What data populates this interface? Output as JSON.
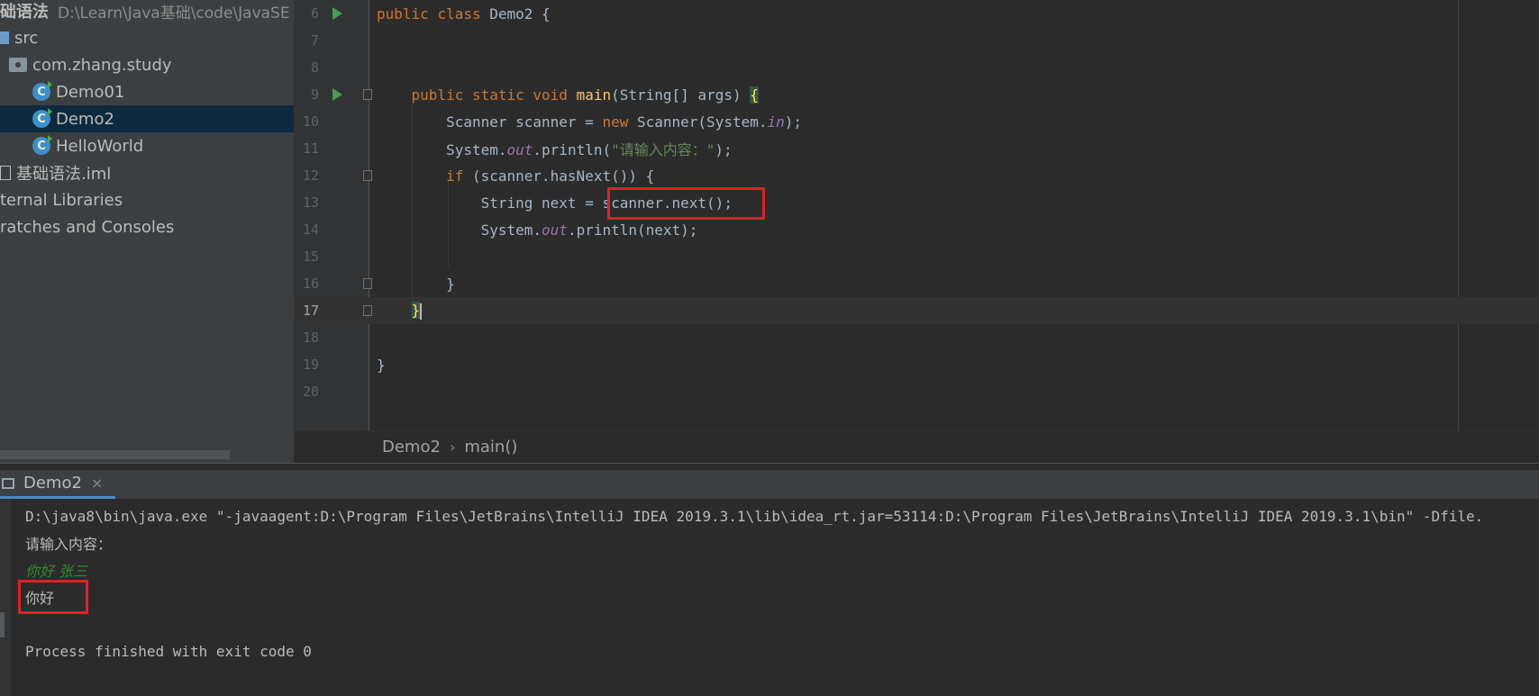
{
  "sidebar": {
    "root_name": "础语法",
    "root_path": "D:\\Learn\\Java基础\\code\\JavaSE",
    "items": [
      {
        "label": "src",
        "icon": "folder-icon"
      },
      {
        "label": "com.zhang.study",
        "icon": "package-icon"
      },
      {
        "label": "Demo01",
        "icon": "java-class-icon"
      },
      {
        "label": "Demo2",
        "icon": "java-class-icon",
        "selected": true
      },
      {
        "label": "HelloWorld",
        "icon": "java-class-icon"
      },
      {
        "label": "基础语法.iml",
        "icon": "module-file-icon"
      },
      {
        "label": "ternal Libraries",
        "icon": ""
      },
      {
        "label": "ratches and Consoles",
        "icon": ""
      }
    ]
  },
  "editor": {
    "line_numbers": [
      "6",
      "7",
      "8",
      "9",
      "10",
      "11",
      "12",
      "13",
      "14",
      "15",
      "16",
      "17",
      "18",
      "19",
      "20"
    ],
    "current_line": "17",
    "tokens": {
      "public": "public",
      "class": "class",
      "static": "static",
      "void": "void",
      "new": "new",
      "if": "if",
      "main": "main",
      "in": "in",
      "out": "out",
      "string_literal": "\"请输入内容：\""
    }
  },
  "breadcrumb": {
    "items": [
      "Demo2",
      "main()"
    ],
    "separator": "›"
  },
  "run_panel": {
    "tab_label": "Demo2",
    "close_glyph": "×",
    "console_lines": [
      "D:\\java8\\bin\\java.exe \"-javaagent:D:\\Program Files\\JetBrains\\IntelliJ IDEA 2019.3.1\\lib\\idea_rt.jar=53114:D:\\Program Files\\JetBrains\\IntelliJ IDEA 2019.3.1\\bin\" -Dfile.",
      "请输入内容：",
      "你好 张三",
      "你好",
      "",
      "Process finished with exit code 0"
    ]
  },
  "colors": {
    "highlight_box": "#e0202a",
    "selected_row": "#0d293e",
    "keyword": "#cc7832",
    "method": "#ffc66d",
    "static_field": "#9876aa",
    "string": "#6a8759",
    "user_input": "#2f8c2f"
  }
}
